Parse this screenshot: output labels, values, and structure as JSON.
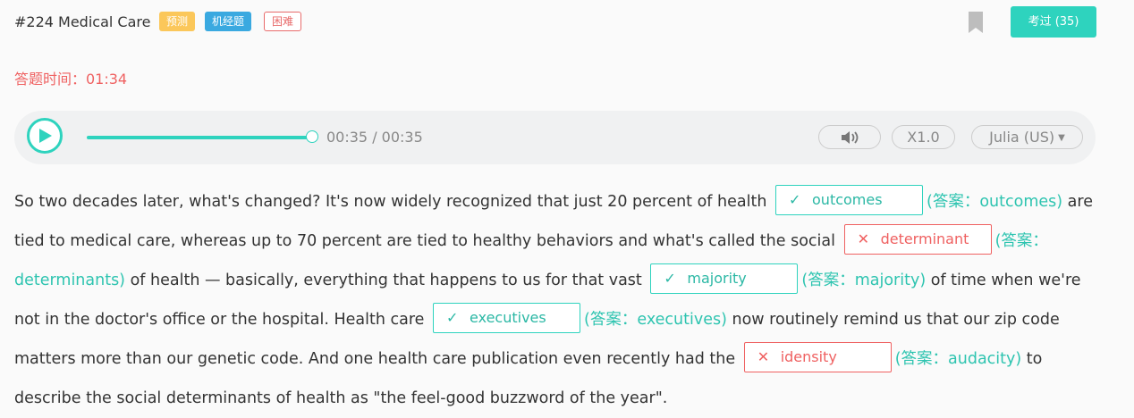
{
  "header": {
    "title": "#224 Medical Care",
    "tags": [
      "预测",
      "机经题",
      "困难"
    ],
    "exam_button": "考过 (35)"
  },
  "timer": "答题时间：01:34",
  "player": {
    "time": "00:35 / 00:35",
    "progress": 1.0,
    "speed": "X1.0",
    "voice": "Julia (US)"
  },
  "passage": {
    "l1": {
      "t1": "So two decades later, what's changed? It's now widely recognized that just 20 percent of health",
      "b1": "outcomes",
      "a1": "(答案：outcomes)",
      "t2": "are"
    },
    "l2": {
      "t1": "tied to medical care, whereas up to 70 percent are tied to healthy behaviors and what's called the social",
      "b1": "determinant",
      "a1": "(答案："
    },
    "l3": {
      "a0": "determinants)",
      "t1": "of health — basically, everything that happens to us for that vast",
      "b1": "majority",
      "a1": "(答案：majority)",
      "t2": "of time when we're"
    },
    "l4": {
      "t1": "not in the doctor's office or the hospital. Health care",
      "b1": "executives",
      "a1": "(答案：executives)",
      "t2": "now routinely remind us that our zip code"
    },
    "l5": {
      "t1": "matters more than our genetic code. And one health care publication even recently had the",
      "b1": "idensity",
      "a1": "(答案：audacity)",
      "t2": "to"
    },
    "l6": {
      "t1": "describe the social determinants of health as \"the feel-good buzzword of the year\"."
    }
  },
  "icons": {
    "check": "✓",
    "cross": "✕",
    "caret": "▼"
  },
  "colors": {
    "accent": "#2ed3be",
    "error": "#ef6161"
  }
}
